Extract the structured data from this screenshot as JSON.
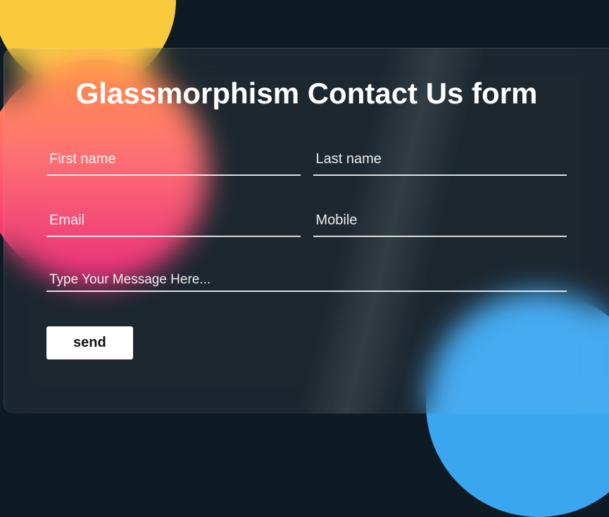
{
  "title": "Glassmorphism Contact Us form",
  "fields": {
    "first_name": {
      "placeholder": "First name",
      "value": ""
    },
    "last_name": {
      "placeholder": "Last name",
      "value": ""
    },
    "email": {
      "placeholder": "Email",
      "value": ""
    },
    "mobile": {
      "placeholder": "Mobile",
      "value": ""
    },
    "message": {
      "placeholder": "Type Your Message Here...",
      "value": ""
    }
  },
  "buttons": {
    "send_label": "send"
  },
  "colors": {
    "background": "#0e1a24",
    "accent_yellow": "#f8c93b",
    "accent_blue": "#3ba6f0",
    "gradient_top": "#ff8a3d",
    "gradient_bottom": "#e91e73"
  }
}
